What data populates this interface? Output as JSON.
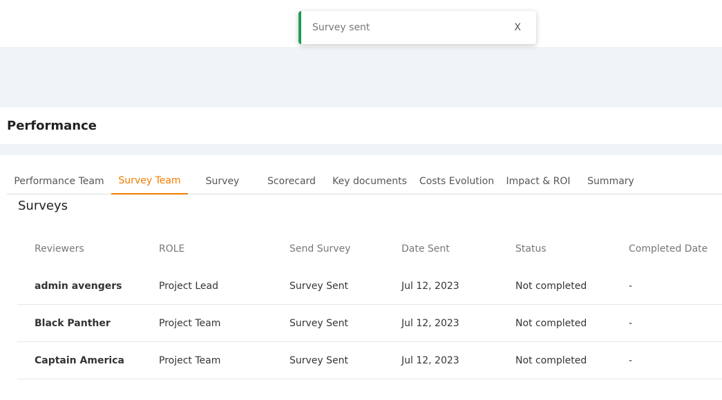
{
  "toast": {
    "message": "Survey sent",
    "close_label": "X"
  },
  "page": {
    "title": "Performance"
  },
  "tabs": [
    {
      "label": "Performance Team",
      "active": false
    },
    {
      "label": "Survey Team",
      "active": true
    },
    {
      "label": "Survey",
      "active": false
    },
    {
      "label": "Scorecard",
      "active": false
    },
    {
      "label": "Key documents",
      "active": false
    },
    {
      "label": "Costs Evolution",
      "active": false
    },
    {
      "label": "Impact & ROI",
      "active": false
    },
    {
      "label": "Summary",
      "active": false
    }
  ],
  "surveys": {
    "title": "Surveys",
    "columns": [
      "Reviewers",
      "ROLE",
      "Send Survey",
      "Date Sent",
      "Status",
      "Completed Date"
    ],
    "rows": [
      [
        "admin avengers",
        "Project Lead",
        "Survey Sent",
        "Jul 12, 2023",
        "Not completed",
        "-"
      ],
      [
        "Black Panther",
        "Project Team",
        "Survey Sent",
        "Jul 12, 2023",
        "Not completed",
        "-"
      ],
      [
        "Captain America",
        "Project Team",
        "Survey Sent",
        "Jul 12, 2023",
        "Not completed",
        "-"
      ]
    ]
  },
  "colors": {
    "accent": "#f07c00",
    "success": "#1f9d55",
    "band": "#f1f4f7"
  }
}
